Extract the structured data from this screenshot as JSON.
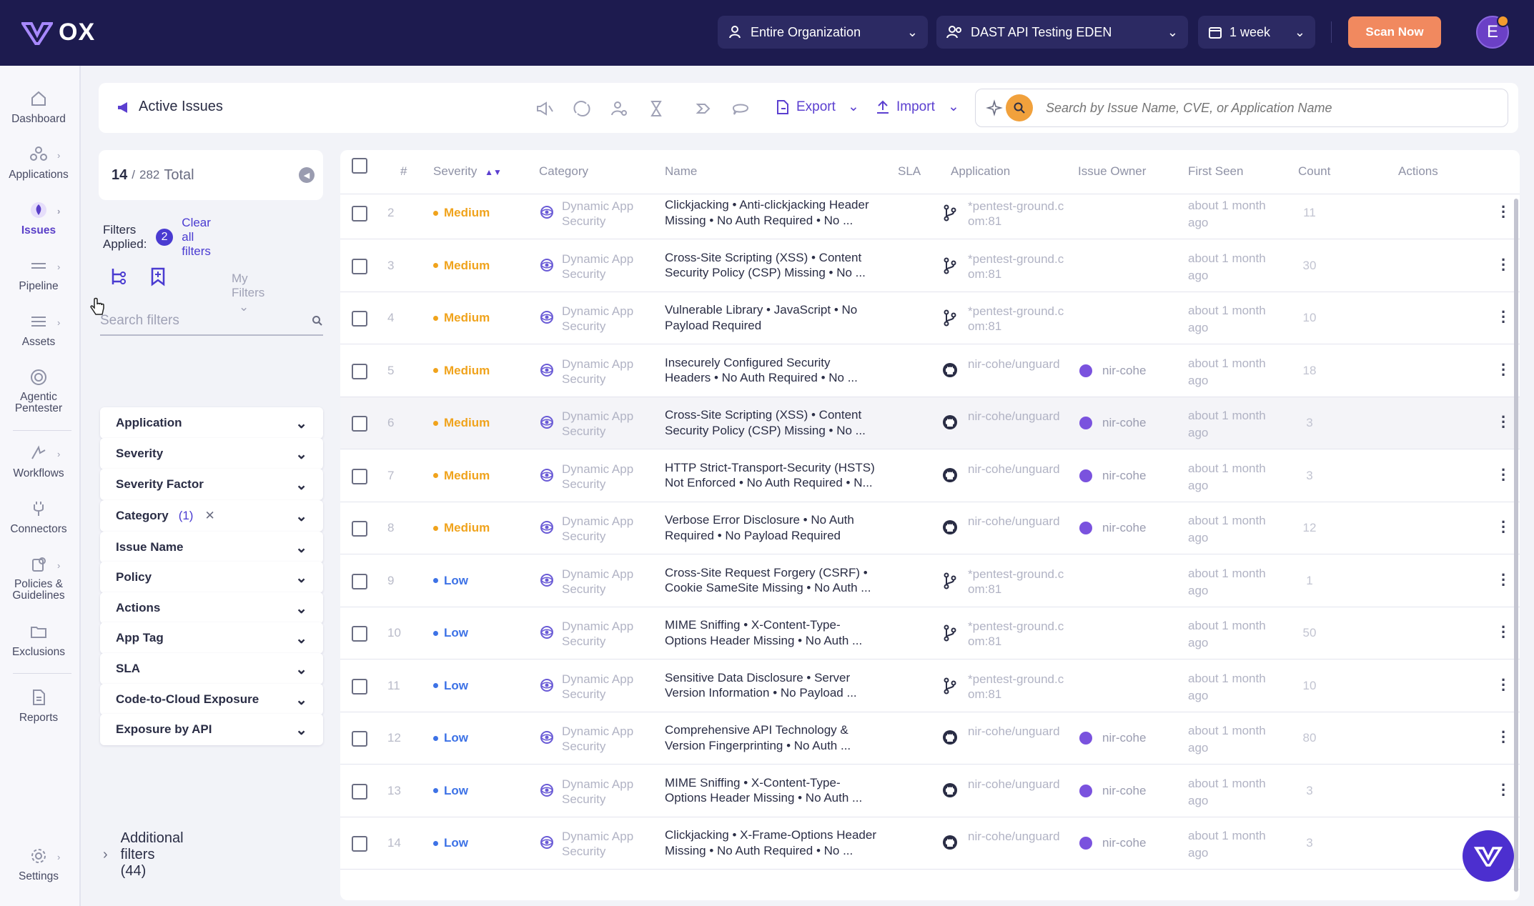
{
  "brand": {
    "name": "OX"
  },
  "topbar": {
    "scope": "Entire Organization",
    "app_group": "DAST API Testing EDEN",
    "period": "1 week",
    "scan_button": "Scan Now",
    "avatar_initial": "E"
  },
  "sidebar": {
    "items": [
      {
        "label": "Dashboard",
        "icon": "home-icon"
      },
      {
        "label": "Applications",
        "icon": "applications-icon"
      },
      {
        "label": "Issues",
        "icon": "issues-icon",
        "active": true
      },
      {
        "label": "Pipeline",
        "icon": "pipeline-icon"
      },
      {
        "label": "Assets",
        "icon": "list-icon"
      },
      {
        "label": "Agentic Pentester",
        "icon": "target-icon"
      },
      {
        "label": "Workflows",
        "icon": "workflow-icon"
      },
      {
        "label": "Connectors",
        "icon": "plug-icon"
      },
      {
        "label": "Policies & Guidelines",
        "icon": "policy-icon"
      },
      {
        "label": "Exclusions",
        "icon": "folder-icon"
      },
      {
        "label": "Reports",
        "icon": "report-icon"
      },
      {
        "label": "Settings",
        "icon": "gear-icon"
      }
    ]
  },
  "header": {
    "title": "Active Issues",
    "export_label": "Export",
    "import_label": "Import",
    "search_placeholder": "Search by Issue Name, CVE, or Application Name"
  },
  "filters": {
    "shown": "14",
    "total": "282",
    "total_label": "Total",
    "applied_label": "Filters Applied:",
    "applied_count": "2",
    "clear_label": "Clear all filters",
    "my_filters": "My Filters",
    "search_placeholder": "Search filters",
    "items": [
      {
        "label": "Application"
      },
      {
        "label": "Severity"
      },
      {
        "label": "Severity Factor"
      },
      {
        "label": "Category",
        "count": "(1)"
      },
      {
        "label": "Issue Name"
      },
      {
        "label": "Policy"
      },
      {
        "label": "Actions"
      },
      {
        "label": "App Tag"
      },
      {
        "label": "SLA"
      },
      {
        "label": "Code-to-Cloud Exposure"
      },
      {
        "label": "Exposure by API"
      }
    ],
    "additional": "Additional filters (44)"
  },
  "table": {
    "columns": [
      "#",
      "Severity",
      "Category",
      "Name",
      "SLA",
      "Application",
      "Issue Owner",
      "First Seen",
      "Count",
      "Actions"
    ],
    "colors": {
      "medium": "#f0a31c",
      "low": "#3d72e6"
    },
    "rows": [
      {
        "num": "2",
        "severity": "Medium",
        "cat1": "Dynamic App",
        "cat2": "Security",
        "name1": "Clickjacking • Anti-clickjacking Header",
        "name2": "Missing • No Auth Required • No ...",
        "app_icon": "branch-icon",
        "app1": "*pentest-ground.c",
        "app2": "om:81",
        "owner": "",
        "seen1": "about 1 month",
        "seen2": "ago",
        "count": "11"
      },
      {
        "num": "3",
        "severity": "Medium",
        "cat1": "Dynamic App",
        "cat2": "Security",
        "name1": "Cross-Site Scripting (XSS) • Content",
        "name2": "Security Policy (CSP) Missing • No ...",
        "app_icon": "branch-icon",
        "app1": "*pentest-ground.c",
        "app2": "om:81",
        "owner": "",
        "seen1": "about 1 month",
        "seen2": "ago",
        "count": "30"
      },
      {
        "num": "4",
        "severity": "Medium",
        "cat1": "Dynamic App",
        "cat2": "Security",
        "name1": "Vulnerable Library • JavaScript • No",
        "name2": "Payload Required",
        "app_icon": "branch-icon",
        "app1": "*pentest-ground.c",
        "app2": "om:81",
        "owner": "",
        "seen1": "about 1 month",
        "seen2": "ago",
        "count": "10"
      },
      {
        "num": "5",
        "severity": "Medium",
        "cat1": "Dynamic App",
        "cat2": "Security",
        "name1": "Insecurely Configured Security",
        "name2": "Headers • No Auth Required • No ...",
        "app_icon": "github-icon",
        "app1": "nir-cohe/unguard",
        "app2": "",
        "owner": "nir-cohe",
        "seen1": "about 1 month",
        "seen2": "ago",
        "count": "18"
      },
      {
        "num": "6",
        "severity": "Medium",
        "cat1": "Dynamic App",
        "cat2": "Security",
        "name1": "Cross-Site Scripting (XSS) • Content",
        "name2": "Security Policy (CSP) Missing • No ...",
        "app_icon": "github-icon",
        "app1": "nir-cohe/unguard",
        "app2": "",
        "owner": "nir-cohe",
        "seen1": "about 1 month",
        "seen2": "ago",
        "count": "3",
        "highlight": true
      },
      {
        "num": "7",
        "severity": "Medium",
        "cat1": "Dynamic App",
        "cat2": "Security",
        "name1": "HTTP Strict-Transport-Security (HSTS)",
        "name2": "Not Enforced • No Auth Required • N...",
        "app_icon": "github-icon",
        "app1": "nir-cohe/unguard",
        "app2": "",
        "owner": "nir-cohe",
        "seen1": "about 1 month",
        "seen2": "ago",
        "count": "3"
      },
      {
        "num": "8",
        "severity": "Medium",
        "cat1": "Dynamic App",
        "cat2": "Security",
        "name1": "Verbose Error Disclosure • No Auth",
        "name2": "Required • No Payload Required",
        "app_icon": "github-icon",
        "app1": "nir-cohe/unguard",
        "app2": "",
        "owner": "nir-cohe",
        "seen1": "about 1 month",
        "seen2": "ago",
        "count": "12"
      },
      {
        "num": "9",
        "severity": "Low",
        "cat1": "Dynamic App",
        "cat2": "Security",
        "name1": "Cross-Site Request Forgery (CSRF) •",
        "name2": "Cookie SameSite Missing • No Auth ...",
        "app_icon": "branch-icon",
        "app1": "*pentest-ground.c",
        "app2": "om:81",
        "owner": "",
        "seen1": "about 1 month",
        "seen2": "ago",
        "count": "1"
      },
      {
        "num": "10",
        "severity": "Low",
        "cat1": "Dynamic App",
        "cat2": "Security",
        "name1": "MIME Sniffing • X-Content-Type-",
        "name2": "Options Header Missing • No Auth ...",
        "app_icon": "branch-icon",
        "app1": "*pentest-ground.c",
        "app2": "om:81",
        "owner": "",
        "seen1": "about 1 month",
        "seen2": "ago",
        "count": "50"
      },
      {
        "num": "11",
        "severity": "Low",
        "cat1": "Dynamic App",
        "cat2": "Security",
        "name1": "Sensitive Data Disclosure • Server",
        "name2": "Version Information • No Payload ...",
        "app_icon": "branch-icon",
        "app1": "*pentest-ground.c",
        "app2": "om:81",
        "owner": "",
        "seen1": "about 1 month",
        "seen2": "ago",
        "count": "10"
      },
      {
        "num": "12",
        "severity": "Low",
        "cat1": "Dynamic App",
        "cat2": "Security",
        "name1": "Comprehensive API Technology &",
        "name2": "Version Fingerprinting • No Auth ...",
        "app_icon": "github-icon",
        "app1": "nir-cohe/unguard",
        "app2": "",
        "owner": "nir-cohe",
        "seen1": "about 1 month",
        "seen2": "ago",
        "count": "80"
      },
      {
        "num": "13",
        "severity": "Low",
        "cat1": "Dynamic App",
        "cat2": "Security",
        "name1": "MIME Sniffing • X-Content-Type-",
        "name2": "Options Header Missing • No Auth ...",
        "app_icon": "github-icon",
        "app1": "nir-cohe/unguard",
        "app2": "",
        "owner": "nir-cohe",
        "seen1": "about 1 month",
        "seen2": "ago",
        "count": "3"
      },
      {
        "num": "14",
        "severity": "Low",
        "cat1": "Dynamic App",
        "cat2": "Security",
        "name1": "Clickjacking • X-Frame-Options Header",
        "name2": "Missing • No Auth Required • No ...",
        "app_icon": "github-icon",
        "app1": "nir-cohe/unguard",
        "app2": "",
        "owner": "nir-cohe",
        "seen1": "about 1 month",
        "seen2": "ago",
        "count": "3"
      }
    ]
  }
}
